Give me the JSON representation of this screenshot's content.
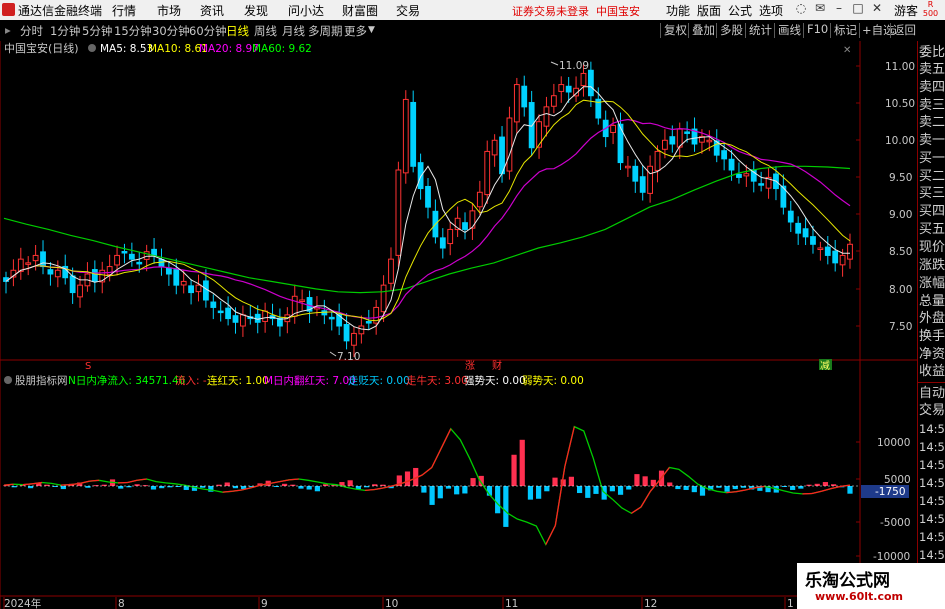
{
  "topbar": {
    "app_name": "通达信金融终端",
    "menus": [
      "行情",
      "市场",
      "资讯",
      "发现",
      "问小达",
      "财富圈",
      "交易"
    ],
    "notice": "证券交易未登录",
    "stock_name": "中国宝安",
    "right_menus": [
      "功能",
      "版面",
      "公式",
      "选项"
    ],
    "guest": "游客",
    "r_badge": "R",
    "r_badge_num": "500"
  },
  "periods": {
    "items": [
      "分时",
      "1分钟",
      "5分钟",
      "15分钟",
      "30分钟",
      "60分钟",
      "日线",
      "周线",
      "月线",
      "多周期",
      "更多"
    ],
    "active": "日线",
    "tools": [
      "复权",
      "叠加",
      "多股",
      "统计",
      "画线",
      "F10",
      "标记",
      "+自选",
      "返回"
    ]
  },
  "main_header": {
    "title": "中国宝安(日线)",
    "ma5": "MA5: 8.53",
    "ma10": "MA10: 8.61",
    "ma20": "MA20: 8.97",
    "ma60": "MA60: 9.62",
    "colors": {
      "ma5": "#ffffff",
      "ma10": "#ffff00",
      "ma20": "#ff00ff",
      "ma60": "#00ff00"
    }
  },
  "main_axis": {
    "labels": [
      "11.00",
      "10.50",
      "10.00",
      "9.50",
      "9.00",
      "8.50",
      "8.00",
      "7.50"
    ],
    "high_label": "11.09",
    "low_label": "7.10",
    "markers": [
      "S",
      "涨",
      "财",
      "减"
    ]
  },
  "indicator_header": {
    "name": "股朋指标网",
    "items": [
      {
        "text": "N日内净流入: 34571.46",
        "color": "#00ff00"
      },
      {
        "text": "流入: -",
        "color": "#ff3030"
      },
      {
        "text": "连红天: 1.00",
        "color": "#ffff00"
      },
      {
        "text": "M日内翻红天: 7.00",
        "color": "#ff00ff"
      },
      {
        "text": "走贬天: 0.00",
        "color": "#00ccff"
      },
      {
        "text": "走牛天: 3.00",
        "color": "#ff3030"
      },
      {
        "text": "强势天: 0.00",
        "color": "#ffffff"
      },
      {
        "text": "弱势天: 0.00",
        "color": "#ffff00"
      }
    ]
  },
  "indicator_axis": {
    "labels": [
      "10000",
      "5000",
      "-5000",
      "-10000"
    ],
    "current": "-1750"
  },
  "xaxis": {
    "labels": [
      "2024年",
      "8",
      "9",
      "10",
      "11",
      "12",
      "1"
    ]
  },
  "sidebar": {
    "items": [
      "委比",
      "卖五",
      "卖四",
      "卖三",
      "卖二",
      "卖一",
      "买一",
      "买二",
      "买三",
      "买四",
      "买五",
      "现价",
      "涨跌",
      "涨幅",
      "总量",
      "外盘",
      "换手",
      "净资",
      "收益"
    ],
    "auto_trade": [
      "自动",
      "交易"
    ],
    "times": [
      "14:56",
      "14:56",
      "14:56",
      "14:56",
      "14:56",
      "14:56",
      "14:56",
      "14:56"
    ]
  },
  "watermark": {
    "line1": "乐淘公式网",
    "line2": "www.60lt.com"
  },
  "chart_data": {
    "type": "candlestick",
    "ylim": [
      7.1,
      11.15
    ],
    "closes": [
      8.1,
      8.25,
      8.4,
      8.35,
      8.45,
      8.3,
      8.2,
      8.25,
      8.15,
      7.95,
      8.05,
      8.2,
      8.1,
      8.25,
      8.3,
      8.45,
      8.5,
      8.4,
      8.35,
      8.5,
      8.45,
      8.3,
      8.2,
      8.05,
      8.1,
      7.95,
      8.05,
      7.85,
      7.75,
      7.7,
      7.6,
      7.55,
      7.65,
      7.6,
      7.55,
      7.7,
      7.6,
      7.5,
      7.65,
      7.9,
      7.85,
      7.7,
      7.75,
      7.65,
      7.6,
      7.5,
      7.3,
      7.4,
      7.5,
      7.55,
      7.75,
      8.05,
      8.4,
      9.6,
      10.55,
      9.65,
      9.35,
      9.1,
      8.7,
      8.55,
      8.8,
      8.95,
      8.8,
      9.05,
      9.3,
      9.85,
      10.0,
      9.55,
      10.3,
      10.75,
      10.45,
      9.9,
      10.25,
      10.45,
      10.6,
      10.75,
      10.65,
      10.7,
      10.9,
      10.6,
      10.3,
      10.05,
      10.2,
      9.7,
      9.65,
      9.45,
      9.3,
      9.65,
      9.85,
      10.0,
      9.95,
      10.15,
      10.1,
      9.95,
      10.05,
      10.0,
      9.8,
      9.75,
      9.6,
      9.5,
      9.55,
      9.45,
      9.4,
      9.5,
      9.35,
      9.1,
      8.9,
      8.75,
      8.7,
      8.6,
      8.55,
      8.45,
      8.35,
      8.45,
      8.6
    ],
    "ma60": [
      8.95,
      8.87,
      8.8,
      8.72,
      8.65,
      8.57,
      8.5,
      8.43,
      8.36,
      8.29,
      8.22,
      8.15,
      8.1,
      8.05,
      8.0,
      7.96,
      7.95,
      7.96,
      8.0,
      8.1,
      8.2,
      8.28,
      8.35,
      8.45,
      8.55,
      8.62,
      8.7,
      8.8,
      8.95,
      9.1,
      9.2,
      9.33,
      9.45,
      9.56,
      9.62,
      9.65,
      9.65,
      9.64,
      9.62
    ],
    "net_inflow": [
      200,
      -300,
      400,
      -500,
      600,
      300,
      -200,
      -700,
      500,
      800,
      -400,
      200,
      300,
      1500,
      -600,
      -300,
      400,
      200,
      -800,
      -500,
      -300,
      -200,
      -900,
      -1100,
      -400,
      -1300,
      300,
      800,
      -500,
      -700,
      -300,
      600,
      1200,
      -200,
      500,
      300,
      -600,
      -800,
      -1200,
      400,
      200,
      900,
      1300,
      -700,
      -300,
      400,
      300,
      -500,
      2400,
      3300,
      4100,
      -1500,
      -4300,
      -2800,
      -600,
      -1900,
      -1700,
      1800,
      2300,
      -2200,
      -6200,
      -9300,
      7100,
      10500,
      -3100,
      -2900,
      -1200,
      1900,
      1500,
      2100,
      -1600,
      -2700,
      -1800,
      -3100,
      -1200,
      -2000,
      -800,
      2700,
      2200,
      1400,
      3500,
      800,
      -700,
      -900,
      -1400,
      -2200,
      -1000,
      -400,
      -1300,
      -700,
      -400,
      -800,
      -1100,
      -1400,
      -1500,
      -200,
      -900,
      -600,
      300,
      500,
      900,
      400,
      -300,
      -1750
    ],
    "indicator_line": [
      200,
      400,
      300,
      500,
      800,
      600,
      200,
      300,
      600,
      1100,
      1300,
      900,
      700,
      800,
      1300,
      1600,
      1000,
      700,
      500,
      200,
      -300,
      -700,
      -1000,
      -1400,
      -1200,
      -900,
      -400,
      200,
      600,
      1000,
      1400,
      1600,
      1300,
      900,
      500,
      300,
      -300,
      -700,
      -1000,
      -800,
      -400,
      100,
      700,
      1500,
      2500,
      4200,
      8600,
      13000,
      10500,
      6200,
      1400,
      -1800,
      -4200,
      -6200,
      -7500,
      -8200,
      -9100,
      -13300,
      -9000,
      4400,
      13500,
      12500,
      6300,
      -1200,
      -3000,
      -5000,
      -6200,
      -4800,
      -1200,
      1400,
      4200,
      3800,
      2200,
      400,
      -600,
      -1200,
      -1500,
      -1300,
      -900,
      -400,
      -100,
      -500,
      -1100,
      -1600,
      -1800,
      -1700,
      -1200,
      -600,
      -100,
      200
    ]
  }
}
